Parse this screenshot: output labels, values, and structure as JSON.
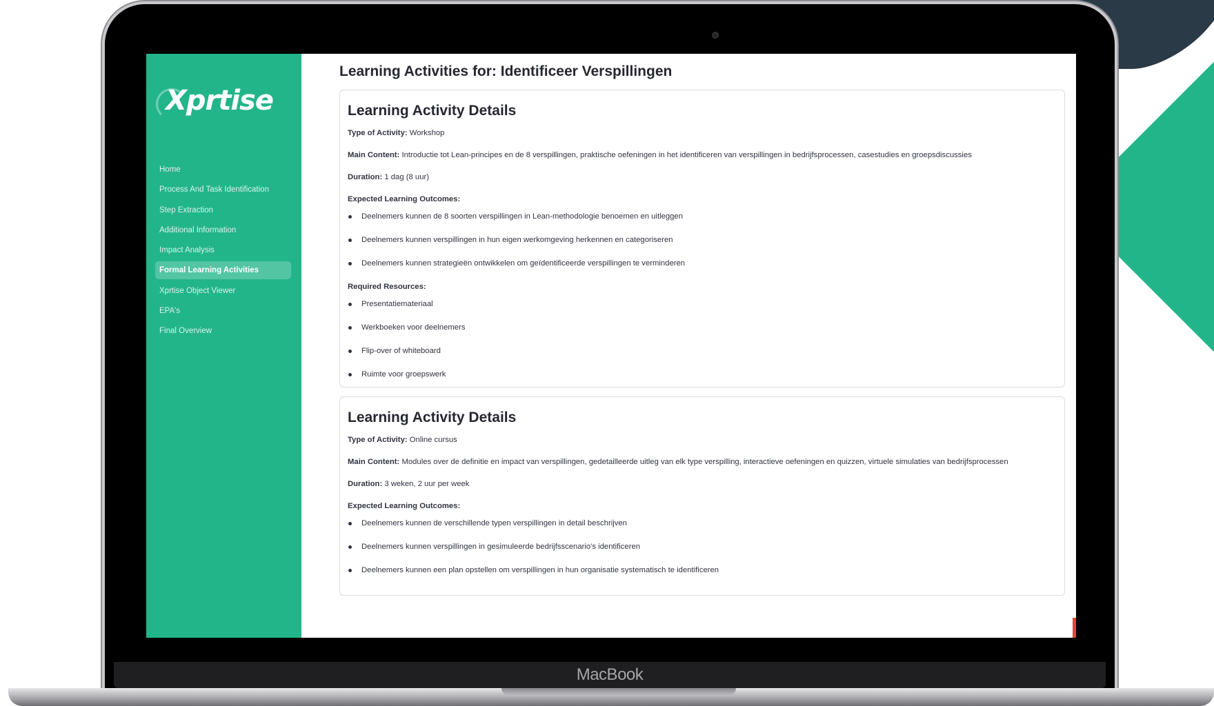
{
  "device": {
    "label": "MacBook"
  },
  "app": {
    "logo_text": "Xprtise"
  },
  "sidebar": {
    "items": [
      {
        "label": "Home",
        "active": false
      },
      {
        "label": "Process And Task Identification",
        "active": false
      },
      {
        "label": "Step Extraction",
        "active": false
      },
      {
        "label": "Additional Information",
        "active": false
      },
      {
        "label": "Impact Analysis",
        "active": false
      },
      {
        "label": "Formal Learning Activities",
        "active": true
      },
      {
        "label": "Xprtise Object Viewer",
        "active": false
      },
      {
        "label": "EPA's",
        "active": false
      },
      {
        "label": "Final Overview",
        "active": false
      }
    ]
  },
  "main": {
    "title": "Learning Activities for: Identificeer Verspillingen",
    "labels": {
      "type": "Type of Activity:",
      "content": "Main Content:",
      "duration": "Duration:",
      "outcomes": "Expected Learning Outcomes:",
      "resources": "Required Resources:"
    },
    "cards": [
      {
        "title": "Learning Activity Details",
        "type": "Workshop",
        "content": "Introductie tot Lean-principes en de 8 verspillingen, praktische oefeningen in het identificeren van verspillingen in bedrijfsprocessen, casestudies en groepsdiscussies",
        "duration": "1 dag (8 uur)",
        "outcomes": [
          "Deelnemers kunnen de 8 soorten verspillingen in Lean-methodologie benoemen en uitleggen",
          "Deelnemers kunnen verspillingen in hun eigen werkomgeving herkennen en categoriseren",
          "Deelnemers kunnen strategieën ontwikkelen om geïdentificeerde verspillingen te verminderen"
        ],
        "resources": [
          "Presentatiemateriaal",
          "Werkboeken voor deelnemers",
          "Flip-over of whiteboard",
          "Ruimte voor groepswerk"
        ]
      },
      {
        "title": "Learning Activity Details",
        "type": "Online cursus",
        "content": "Modules over de definitie en impact van verspillingen, gedetailleerde uitleg van elk type verspilling, interactieve oefeningen en quizzen, virtuele simulaties van bedrijfsprocessen",
        "duration": "3 weken, 2 uur per week",
        "outcomes": [
          "Deelnemers kunnen de verschillende typen verspillingen in detail beschrijven",
          "Deelnemers kunnen verspillingen in gesimuleerde bedrijfsscenario's identificeren",
          "Deelnemers kunnen een plan opstellen om verspillingen in hun organisatie systematisch te identificeren"
        ]
      }
    ]
  },
  "colors": {
    "sidebar_bg": "#23b58a",
    "accent_dark": "#2b3a47",
    "text": "#262730"
  }
}
